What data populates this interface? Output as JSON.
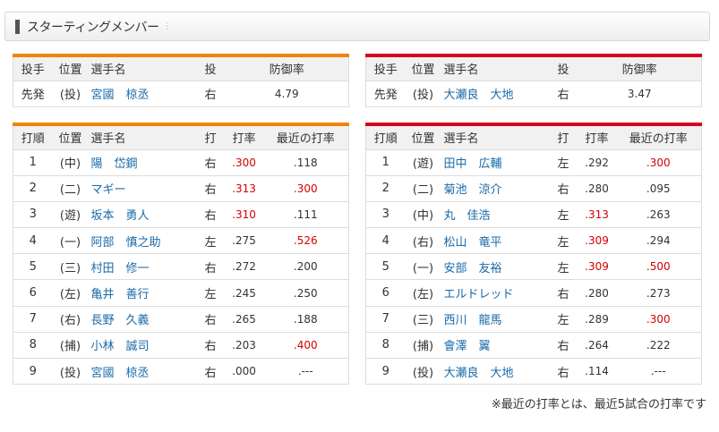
{
  "header": {
    "title": "スターティングメンバー"
  },
  "pitchers": {
    "columns": [
      "投手",
      "位置",
      "選手名",
      "投",
      "防御率"
    ],
    "left": {
      "role": "先発",
      "pos": "(投)",
      "name": "宮國　椋丞",
      "throws": "右",
      "era": "4.79"
    },
    "right": {
      "role": "先発",
      "pos": "(投)",
      "name": "大瀬良　大地",
      "throws": "右",
      "era": "3.47"
    }
  },
  "lineups": {
    "columns": [
      "打順",
      "位置",
      "選手名",
      "打",
      "打率",
      "最近の打率"
    ],
    "left": [
      {
        "order": "1",
        "pos": "(中)",
        "name": "陽　岱鋼",
        "bats": "右",
        "avg": ".300",
        "recent": ".118",
        "avg_hot": true,
        "recent_hot": false
      },
      {
        "order": "2",
        "pos": "(二)",
        "name": "マギー",
        "bats": "右",
        "avg": ".313",
        "recent": ".300",
        "avg_hot": true,
        "recent_hot": true
      },
      {
        "order": "3",
        "pos": "(遊)",
        "name": "坂本　勇人",
        "bats": "右",
        "avg": ".310",
        "recent": ".111",
        "avg_hot": true,
        "recent_hot": false
      },
      {
        "order": "4",
        "pos": "(一)",
        "name": "阿部　慎之助",
        "bats": "左",
        "avg": ".275",
        "recent": ".526",
        "avg_hot": false,
        "recent_hot": true
      },
      {
        "order": "5",
        "pos": "(三)",
        "name": "村田　修一",
        "bats": "右",
        "avg": ".272",
        "recent": ".200",
        "avg_hot": false,
        "recent_hot": false
      },
      {
        "order": "6",
        "pos": "(左)",
        "name": "亀井　善行",
        "bats": "左",
        "avg": ".245",
        "recent": ".250",
        "avg_hot": false,
        "recent_hot": false
      },
      {
        "order": "7",
        "pos": "(右)",
        "name": "長野　久義",
        "bats": "右",
        "avg": ".265",
        "recent": ".188",
        "avg_hot": false,
        "recent_hot": false
      },
      {
        "order": "8",
        "pos": "(捕)",
        "name": "小林　誠司",
        "bats": "右",
        "avg": ".203",
        "recent": ".400",
        "avg_hot": false,
        "recent_hot": true
      },
      {
        "order": "9",
        "pos": "(投)",
        "name": "宮國　椋丞",
        "bats": "右",
        "avg": ".000",
        "recent": ".---",
        "avg_hot": false,
        "recent_hot": false
      }
    ],
    "right": [
      {
        "order": "1",
        "pos": "(遊)",
        "name": "田中　広輔",
        "bats": "左",
        "avg": ".292",
        "recent": ".300",
        "avg_hot": false,
        "recent_hot": true
      },
      {
        "order": "2",
        "pos": "(二)",
        "name": "菊池　涼介",
        "bats": "右",
        "avg": ".280",
        "recent": ".095",
        "avg_hot": false,
        "recent_hot": false
      },
      {
        "order": "3",
        "pos": "(中)",
        "name": "丸　佳浩",
        "bats": "左",
        "avg": ".313",
        "recent": ".263",
        "avg_hot": true,
        "recent_hot": false
      },
      {
        "order": "4",
        "pos": "(右)",
        "name": "松山　竜平",
        "bats": "左",
        "avg": ".309",
        "recent": ".294",
        "avg_hot": true,
        "recent_hot": false
      },
      {
        "order": "5",
        "pos": "(一)",
        "name": "安部　友裕",
        "bats": "左",
        "avg": ".309",
        "recent": ".500",
        "avg_hot": true,
        "recent_hot": true
      },
      {
        "order": "6",
        "pos": "(左)",
        "name": "エルドレッド",
        "bats": "右",
        "avg": ".280",
        "recent": ".273",
        "avg_hot": false,
        "recent_hot": false
      },
      {
        "order": "7",
        "pos": "(三)",
        "name": "西川　龍馬",
        "bats": "左",
        "avg": ".289",
        "recent": ".300",
        "avg_hot": false,
        "recent_hot": true
      },
      {
        "order": "8",
        "pos": "(捕)",
        "name": "會澤　翼",
        "bats": "右",
        "avg": ".264",
        "recent": ".222",
        "avg_hot": false,
        "recent_hot": false
      },
      {
        "order": "9",
        "pos": "(投)",
        "name": "大瀬良　大地",
        "bats": "右",
        "avg": ".114",
        "recent": ".---",
        "avg_hot": false,
        "recent_hot": false
      }
    ]
  },
  "footnote": "※最近の打率とは、最近5試合の打率です",
  "colors": {
    "home_accent": "#f08300",
    "away_accent": "#d7001f",
    "hot": "#d40000",
    "link": "#1a6aa8"
  }
}
